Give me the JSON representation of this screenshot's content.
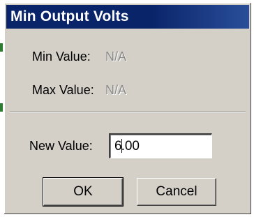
{
  "dialog": {
    "title": "Min Output Volts",
    "min_label": "Min Value:",
    "min_value": "N/A",
    "max_label": "Max Value:",
    "max_value": "N/A",
    "new_value_label": "New Value:",
    "new_value_before_caret": "6",
    "new_value_after_caret": ".00",
    "ok_label": "OK",
    "cancel_label": "Cancel"
  },
  "colors": {
    "titlebar": "#0a246a",
    "dialog_face": "#d4d0c8",
    "disabled_text": "#8a8a8a"
  }
}
